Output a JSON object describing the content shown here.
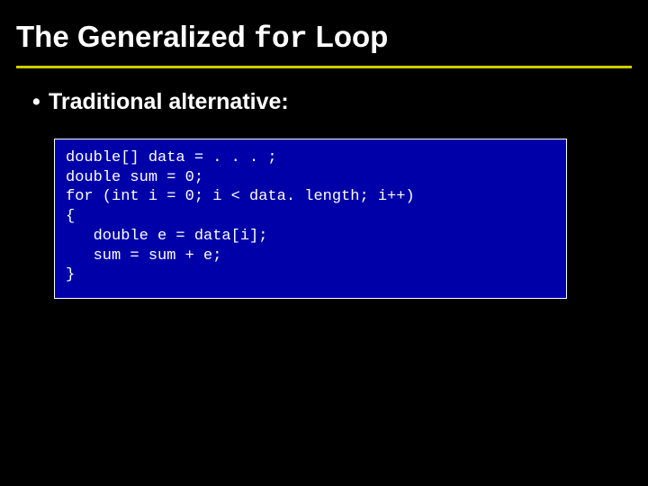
{
  "title": {
    "part1": "The Generalized ",
    "mono": "for",
    "part2": " Loop"
  },
  "bullet": {
    "marker": "•",
    "text": "Traditional alternative:"
  },
  "code": "double[] data = . . . ;\ndouble sum = 0;\nfor (int i = 0; i < data. length; i++)\n{\n   double e = data[i];\n   sum = sum + e;\n}"
}
